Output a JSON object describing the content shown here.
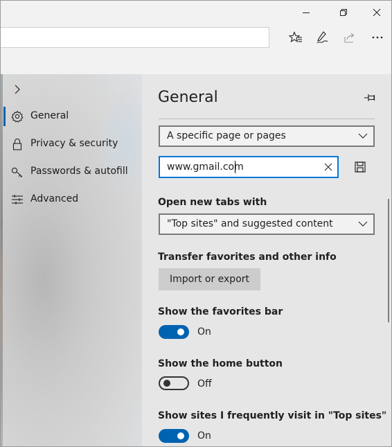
{
  "window_controls": {
    "minimize_icon": "minimize-icon",
    "restore_icon": "restore-icon",
    "close_icon": "close-icon"
  },
  "toolbar": {
    "address_value": "",
    "icons": [
      "favorites-star-icon",
      "pen-icon",
      "share-icon",
      "more-icon"
    ]
  },
  "nav": {
    "expand_icon": "chevron-right-icon",
    "items": [
      {
        "label": "General",
        "icon": "gear-icon",
        "selected": true
      },
      {
        "label": "Privacy & security",
        "icon": "lock-icon",
        "selected": false
      },
      {
        "label": "Passwords & autofill",
        "icon": "key-icon",
        "selected": false
      },
      {
        "label": "Advanced",
        "icon": "sliders-icon",
        "selected": false
      }
    ]
  },
  "panel": {
    "title": "General",
    "pin_icon": "pin-icon",
    "startup_select": "A specific page or pages",
    "url_input": "www.gmail.com",
    "new_tabs_label": "Open new tabs with",
    "new_tabs_select": "\"Top sites\" and suggested content",
    "transfer_label": "Transfer favorites and other info",
    "import_button": "Import or export",
    "favorites_bar_label": "Show the favorites bar",
    "favorites_bar_state": "On",
    "home_button_label": "Show the home button",
    "home_button_state": "Off",
    "top_sites_label": "Show sites I frequently visit in \"Top sites\"",
    "top_sites_state": "On"
  },
  "colors": {
    "accent": "#0063b1",
    "focus_border": "#0078d7",
    "panel_bg": "#e6e6e6"
  }
}
